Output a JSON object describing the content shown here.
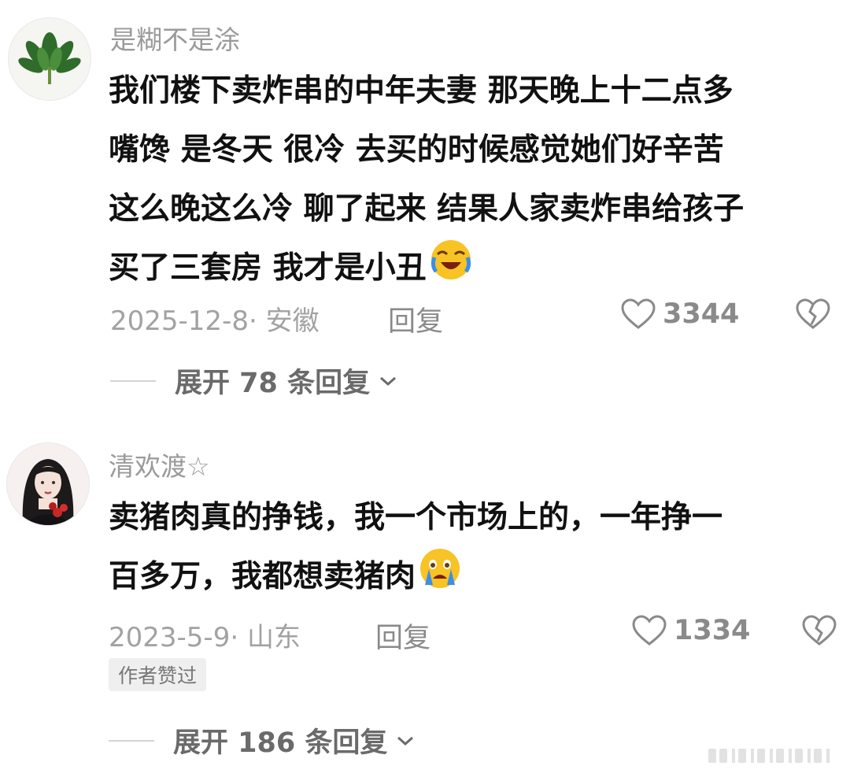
{
  "comments": [
    {
      "username": "是糊不是涂",
      "lines": [
        "我们楼下卖炸串的中年夫妻 那天晚上十二点多",
        "嘴馋 是冬天 很冷 去买的时候感觉她们好辛苦",
        "这么晚这么冷 聊了起来 结果人家卖炸串给孩子",
        "买了三套房 我才是小丑"
      ],
      "emoji": "laughing-crying-emoji",
      "date_location": "2025-12-8· 安徽",
      "reply_label": "回复",
      "likes": "3344",
      "expand_label": "展开 78 条回复"
    },
    {
      "username": "清欢渡☆",
      "lines": [
        "卖猪肉真的挣钱，我一个市场上的，一年挣一",
        "百多万，我都想卖猪肉"
      ],
      "emoji": "crying-emoji",
      "date_location": "2023-5-9· 山东",
      "reply_label": "回复",
      "likes": "1334",
      "badge": "作者赞过",
      "expand_label": "展开 186 条回复"
    }
  ],
  "colors": {
    "text": "#111111",
    "meta": "#a2a2a2",
    "emoji_yellow": "#f7c325",
    "tear_blue": "#3b8eea"
  }
}
